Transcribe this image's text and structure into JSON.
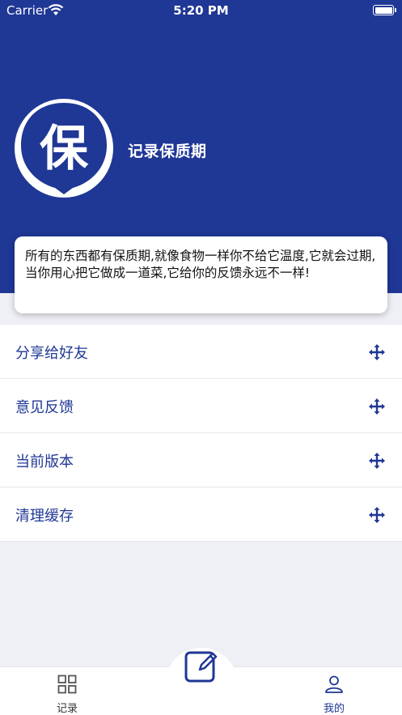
{
  "status_bar": {
    "carrier": "Carrier",
    "time": "5:20 PM"
  },
  "header": {
    "logo_char": "保",
    "app_name": "记录保质期"
  },
  "intro": {
    "text": "所有的东西都有保质期,就像食物一样你不给它温度,它就会过期,当你用心把它做成一道菜,它给你的反馈永远不一样!"
  },
  "menu": {
    "items": [
      {
        "label": "分享给好友",
        "icon": "move-icon"
      },
      {
        "label": "意见反馈",
        "icon": "move-icon"
      },
      {
        "label": "当前版本",
        "icon": "move-icon"
      },
      {
        "label": "清理缓存",
        "icon": "move-icon"
      }
    ]
  },
  "tabbar": {
    "tabs": [
      {
        "label": "记录",
        "icon": "grid-icon"
      },
      {
        "label": "我的",
        "icon": "person-icon",
        "active": true
      }
    ],
    "center_icon": "edit-icon"
  },
  "colors": {
    "brand": "#1f3795",
    "background": "#efeff6"
  }
}
